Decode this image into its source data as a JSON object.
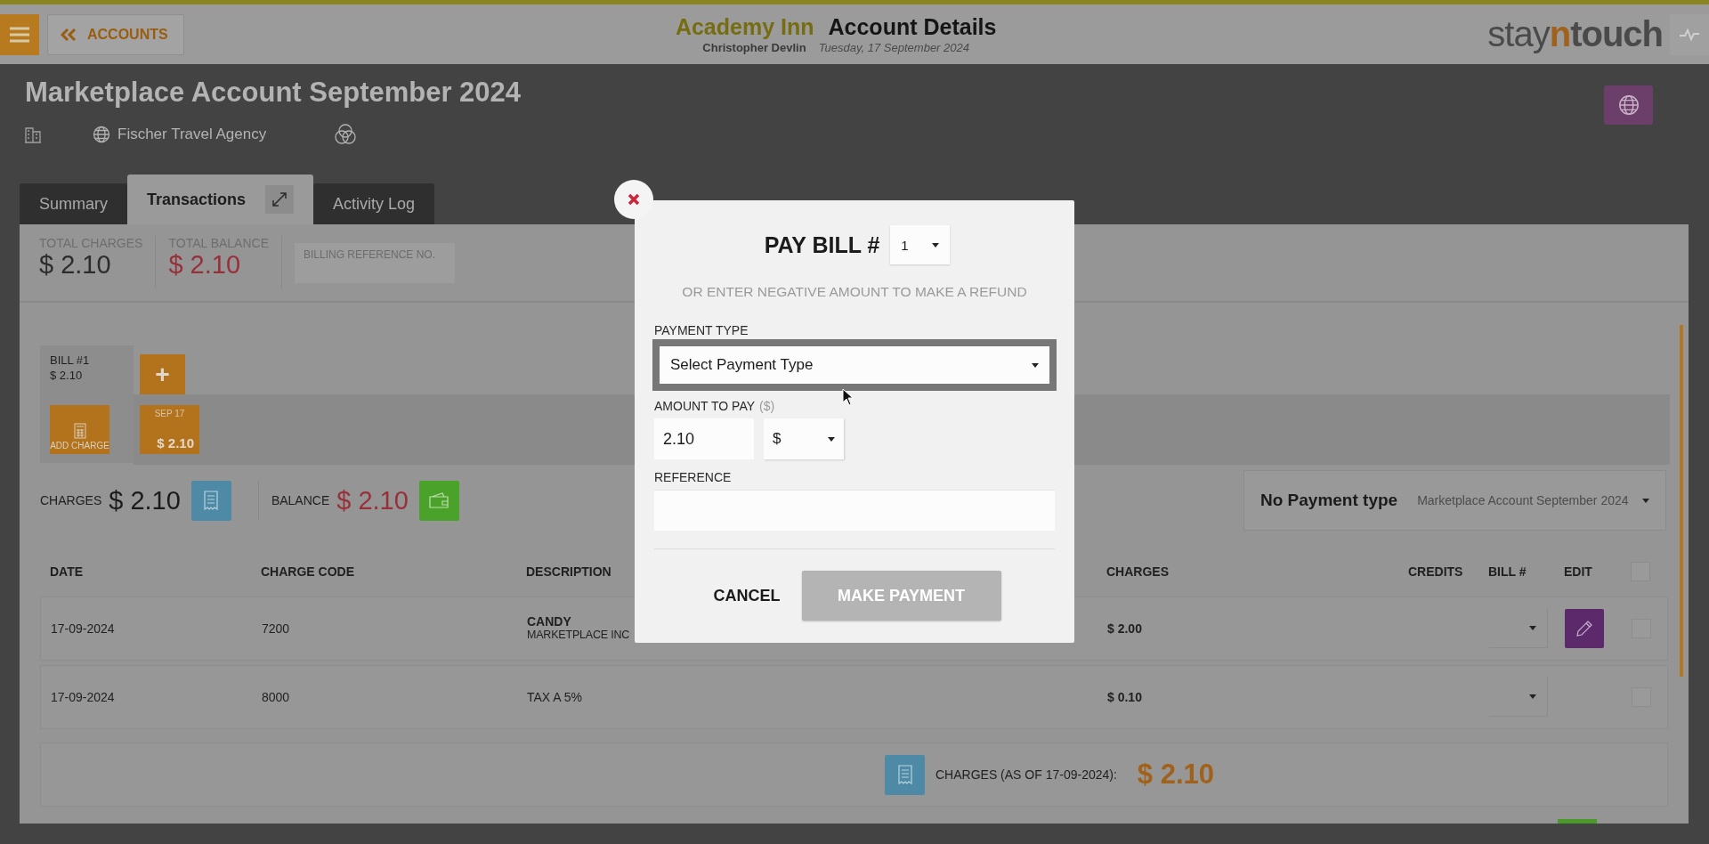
{
  "header": {
    "accounts_button": "ACCOUNTS",
    "hotel": "Academy Inn",
    "page_title": "Account Details",
    "user": "Christopher Devlin",
    "date": "Tuesday, 17 September 2024",
    "logo": [
      "stay",
      "n",
      "touch"
    ]
  },
  "account": {
    "title": "Marketplace Account September 2024",
    "company": "Fischer Travel Agency"
  },
  "tabs": [
    {
      "label": "Summary",
      "selected": false
    },
    {
      "label": "Transactions",
      "selected": true
    },
    {
      "label": "Activity Log",
      "selected": false
    }
  ],
  "totals": [
    {
      "label": "TOTAL CHARGES",
      "value": "$ 2.10",
      "kind": "neutral"
    },
    {
      "label": "TOTAL BALANCE",
      "value": "$ 2.10",
      "kind": "due"
    }
  ],
  "billing_reference": {
    "label": "BILLING REFERENCE NO."
  },
  "bills": [
    {
      "label": "BILL #1",
      "amount": "$ 2.10",
      "selected": true
    }
  ],
  "add_bill_button": "+",
  "add_charge_button": "ADD CHARGE",
  "date_cards": [
    {
      "date": "SEP 17",
      "amount": "$ 2.10"
    }
  ],
  "summary": {
    "charges_label": "CHARGES",
    "charges": "$ 2.10",
    "balance_label": "BALANCE",
    "balance": "$ 2.10"
  },
  "payment_type_panel": {
    "label": "No Payment type",
    "selector": "Marketplace Account September 2024"
  },
  "table": {
    "columns": [
      "DATE",
      "CHARGE CODE",
      "DESCRIPTION",
      "CHARGES",
      "CREDITS",
      "BILL #",
      "EDIT"
    ],
    "select_all": {
      "checked": false
    },
    "rows": [
      {
        "date": "17-09-2024",
        "charge_code": "7200",
        "description": "CANDY",
        "description_detail": "MARKETPLACE INC",
        "charges": "$ 2.00",
        "editable": true,
        "checked": false
      },
      {
        "date": "17-09-2024",
        "charge_code": "8000",
        "description": "TAX A 5%",
        "charges": "$ 0.10",
        "editable": false,
        "checked": false
      }
    ]
  },
  "total_line": {
    "label": "CHARGES (AS OF 17-09-2024):",
    "value": "$ 2.10"
  },
  "modal": {
    "title": "PAY BILL #",
    "bill_select": "1",
    "hint": "OR ENTER NEGATIVE AMOUNT TO MAKE A REFUND",
    "payment_type": {
      "label": "PAYMENT TYPE",
      "value": "Select Payment Type",
      "focused": true
    },
    "amount": {
      "label": "AMOUNT TO PAY",
      "unit": "($)",
      "value": "2.10",
      "currency": "$"
    },
    "reference": {
      "label": "REFERENCE"
    },
    "cancel": "CANCEL",
    "submit": {
      "label": "MAKE PAYMENT",
      "disabled": true
    }
  }
}
